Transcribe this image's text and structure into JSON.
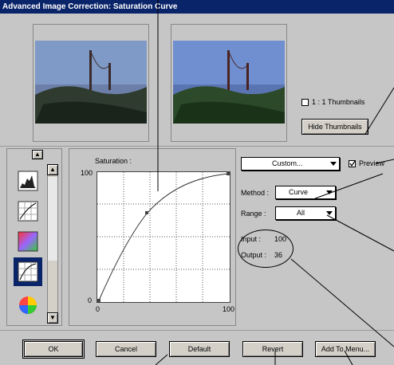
{
  "window": {
    "title": "Advanced Image Correction: Saturation Curve"
  },
  "thumbnails": {
    "one_to_one_label": "1 : 1 Thumbnails",
    "one_to_one_checked": false,
    "hide_button": "Hide Thumbnails"
  },
  "sidebar": {
    "items": [
      {
        "name": "levels-icon"
      },
      {
        "name": "tone-curve-icon"
      },
      {
        "name": "color-balance-icon"
      },
      {
        "name": "saturation-curve-icon",
        "selected": true
      },
      {
        "name": "hue-wheel-icon"
      }
    ]
  },
  "graph": {
    "label": "Saturation :",
    "y_max_label": "100",
    "y_min_label": "0",
    "x_min_label": "0",
    "x_max_label": "100"
  },
  "controls": {
    "preset_value": "Custom...",
    "preview_label": "Preview",
    "preview_checked": true,
    "method_label": "Method :",
    "method_value": "Curve",
    "range_label": "Range :",
    "range_value": "All",
    "input_label": "Input :",
    "input_value": "100",
    "output_label": "Output :",
    "output_value": "36"
  },
  "buttons": {
    "ok": "OK",
    "cancel": "Cancel",
    "default": "Default",
    "revert": "Revert",
    "add_to_menu": "Add To Menu..."
  }
}
